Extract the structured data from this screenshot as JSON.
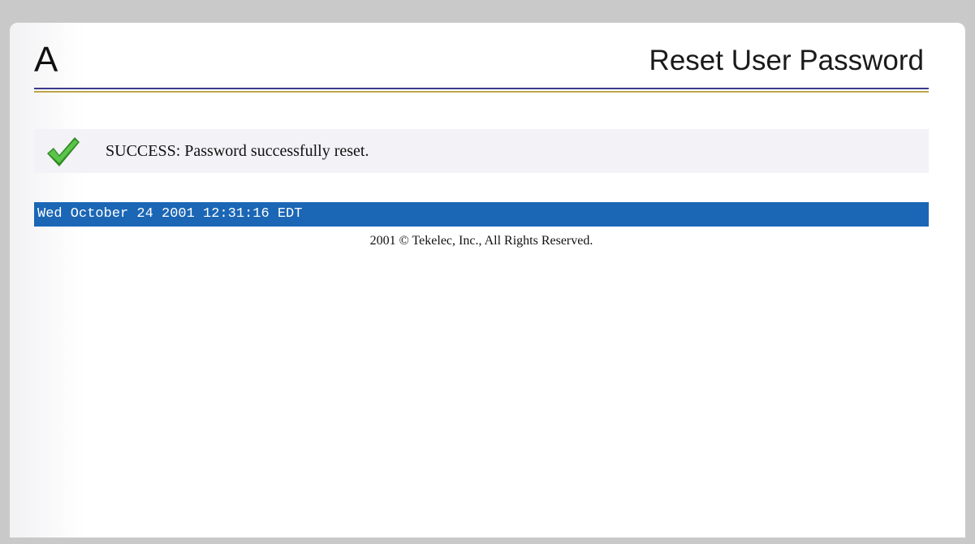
{
  "header": {
    "letter": "A",
    "title": "Reset User Password"
  },
  "status": {
    "icon": "checkmark-icon",
    "message": "SUCCESS: Password successfully reset."
  },
  "footer": {
    "datetime": "Wed October 24 2001 12:31:16 EDT",
    "copyright": "2001 © Tekelec, Inc., All Rights Reserved."
  },
  "colors": {
    "date_bar": "#1b66b5",
    "rule_blue": "#3a3a8c",
    "rule_gold": "#bfa54a",
    "check_green": "#3a9a2a"
  }
}
